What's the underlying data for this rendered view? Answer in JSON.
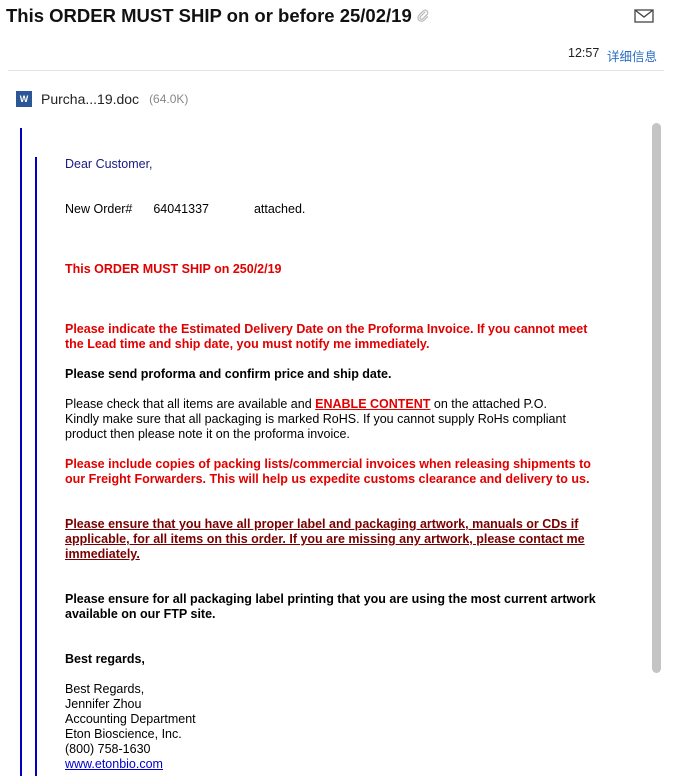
{
  "header": {
    "subject": "This ORDER MUST SHIP on or before 25/02/19",
    "time": "12:57",
    "details_link": "详细信息"
  },
  "attachment": {
    "icon": "W",
    "name": "Purcha...19.doc",
    "size": "(64.0K)"
  },
  "body": {
    "greeting": "Dear Customer,",
    "order_label": "New Order#",
    "order_number": "64041337",
    "order_suffix": "attached.",
    "must_ship": "This ORDER MUST SHIP on 250/2/19",
    "indicate_1": "Please indicate the Estimated Delivery Date on the Proforma Invoice. If you cannot meet",
    "indicate_2": "the Lead time and ship date, you must notify me immediately.",
    "send_proforma": "Please send proforma and confirm price and ship date.",
    "check_prefix": "Please check that all items are available and ",
    "enable_content": "ENABLE CONTENT",
    "check_suffix": " on the attached P.O.",
    "rohs_1": "Kindly make sure  that all packaging is marked RoHS. If you cannot supply RoHs compliant",
    "rohs_2": "product then please note it on the proforma invoice.",
    "packing_1": "Please include copies of packing lists/commercial invoices when releasing shipments to",
    "packing_2": "our Freight Forwarders. This will help us expedite customs clearance and delivery to us.",
    "artwork_1": "Please ensure that you have all proper label and packaging artwork, manuals or CDs if",
    "artwork_2": "applicable, for all items on this order. If you are missing any artwork, please contact me",
    "artwork_3": "immediately.",
    "ftp_1": "Please ensure for all packaging label printing that you are using the most current artwork",
    "ftp_2": "available on our FTP site.",
    "best_regards_bold": "Best regards,",
    "sig_regards": "Best Regards,",
    "sig_name": "Jennifer Zhou",
    "sig_dept": "Accounting Department",
    "sig_company": "Eton Bioscience, Inc.",
    "sig_phone": "(800) 758-1630",
    "sig_web": "www.etonbio.com"
  },
  "icons": {
    "attachment_clip": "paperclip-icon",
    "mail": "envelope-icon",
    "word_doc": "word-doc-icon"
  },
  "colors": {
    "link": "#2a6dc4",
    "alert_red": "#e00000",
    "quote_bar": "#0000bf"
  }
}
